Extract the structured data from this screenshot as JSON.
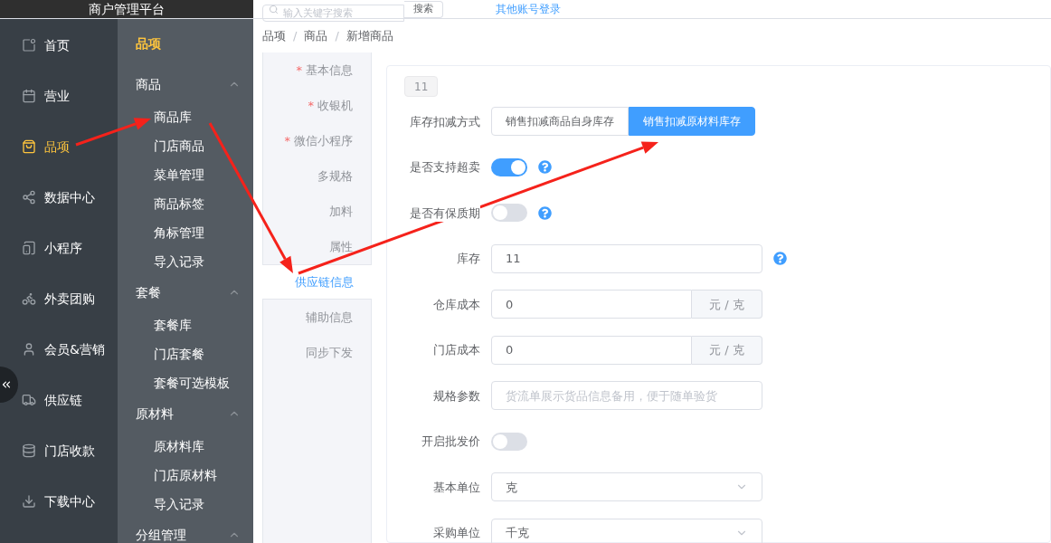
{
  "header": {
    "title": "商户管理平台",
    "search_placeholder": "输入关键字搜索",
    "search_button": "搜索",
    "link": "其他账号登录"
  },
  "nav": [
    {
      "label": "首页",
      "selected": false
    },
    {
      "label": "营业",
      "selected": false
    },
    {
      "label": "品项",
      "selected": true
    },
    {
      "label": "数据中心",
      "selected": false
    },
    {
      "label": "小程序",
      "selected": false
    },
    {
      "label": "外卖团购",
      "selected": false
    },
    {
      "label": "会员&营销",
      "selected": false
    },
    {
      "label": "供应链",
      "selected": false
    },
    {
      "label": "门店收款",
      "selected": false
    },
    {
      "label": "下载中心",
      "selected": false
    }
  ],
  "submenu": {
    "title": "品项",
    "groups": [
      {
        "label": "商品",
        "expanded": true,
        "children": [
          {
            "label": "商品库"
          },
          {
            "label": "门店商品"
          },
          {
            "label": "菜单管理"
          },
          {
            "label": "商品标签"
          },
          {
            "label": "角标管理"
          },
          {
            "label": "导入记录"
          }
        ]
      },
      {
        "label": "套餐",
        "expanded": true,
        "children": [
          {
            "label": "套餐库"
          },
          {
            "label": "门店套餐"
          },
          {
            "label": "套餐可选模板"
          }
        ]
      },
      {
        "label": "原材料",
        "expanded": true,
        "children": [
          {
            "label": "原材料库"
          },
          {
            "label": "门店原材料"
          },
          {
            "label": "导入记录"
          }
        ]
      },
      {
        "label": "分组管理",
        "expanded": true
      }
    ]
  },
  "breadcrumb": [
    "品项",
    "商品",
    "新增商品"
  ],
  "breadcrumb_separator": "/",
  "required_mark": "*",
  "tabs": [
    {
      "label": "基本信息",
      "required": true,
      "selected": false
    },
    {
      "label": "收银机",
      "required": true,
      "selected": false
    },
    {
      "label": "微信小程序",
      "required": true,
      "selected": false
    },
    {
      "label": "多规格",
      "required": false,
      "selected": false
    },
    {
      "label": "加料",
      "required": false,
      "selected": false
    },
    {
      "label": "属性",
      "required": false,
      "selected": false
    },
    {
      "label": "供应链信息",
      "required": false,
      "selected": true
    },
    {
      "label": "辅助信息",
      "required": false,
      "selected": false
    },
    {
      "label": "同步下发",
      "required": false,
      "selected": false
    }
  ],
  "form": {
    "tag": "11",
    "rows": [
      {
        "kind": "segmented",
        "label": "库存扣减方式",
        "options": [
          {
            "label": "销售扣减商品自身库存",
            "selected": false
          },
          {
            "label": "销售扣减原材料库存",
            "selected": true
          }
        ]
      },
      {
        "kind": "switch",
        "label": "是否支持超卖",
        "on": true,
        "help": true
      },
      {
        "kind": "switch",
        "label": "是否有保质期",
        "on": false,
        "help": true
      },
      {
        "kind": "input",
        "label": "库存",
        "value": "11",
        "help": true
      },
      {
        "kind": "input_unit",
        "label": "仓库成本",
        "value": "0",
        "unit": "元 / 克"
      },
      {
        "kind": "input_unit",
        "label": "门店成本",
        "value": "0",
        "unit": "元 / 克"
      },
      {
        "kind": "input",
        "label": "规格参数",
        "placeholder": "货流单展示货品信息备用，便于随单验货"
      },
      {
        "kind": "switch",
        "label": "开启批发价",
        "on": false
      },
      {
        "kind": "select",
        "label": "基本单位",
        "value": "克"
      },
      {
        "kind": "select",
        "label": "采购单位",
        "value": "千克"
      }
    ]
  },
  "annotations": [
    {
      "kind": "arrow"
    },
    {
      "kind": "arrow"
    },
    {
      "kind": "arrow"
    }
  ]
}
